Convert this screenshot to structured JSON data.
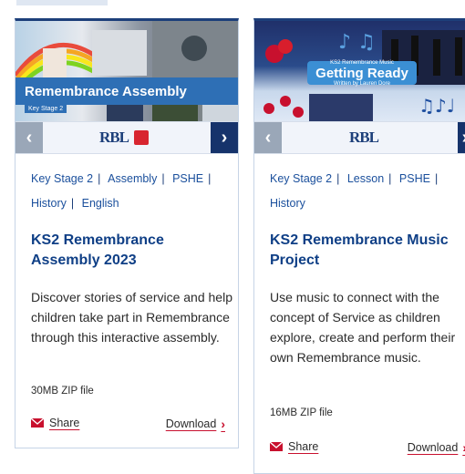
{
  "cards": [
    {
      "banner": {
        "title": "Remembrance Assembly",
        "badge": "Key Stage 2"
      },
      "logo": "RBL",
      "tags": [
        "Key Stage 2",
        "Assembly",
        "PSHE",
        "History",
        "English"
      ],
      "title": "KS2 Remembrance Assembly 2023",
      "description": "Discover stories of service and help children take part in Remembrance through this interactive assembly.",
      "file_size": "30MB ZIP file",
      "share_label": "Share",
      "download_label": "Download"
    },
    {
      "banner": {
        "title": "Getting Ready",
        "kicker": "KS2 Remembrance Music",
        "byline": "Written by Lauren Dore"
      },
      "logo": "RBL",
      "tags": [
        "Key Stage 2",
        "Lesson",
        "PSHE",
        "History"
      ],
      "title": "KS2 Remembrance Music Project",
      "description": "Use music to connect with the concept of Service as children explore, create and perform their own Remembrance music.",
      "file_size": "16MB ZIP file",
      "share_label": "Share",
      "download_label": "Download"
    }
  ],
  "colors": {
    "navy": "#16336b",
    "link_blue": "#1a4f9c",
    "title_blue": "#0f3f86",
    "accent_red": "#c8102e"
  },
  "icons": {
    "prev": "chevron-left-icon",
    "next": "chevron-right-icon",
    "share": "envelope-icon",
    "download": "chevron-right-icon"
  }
}
